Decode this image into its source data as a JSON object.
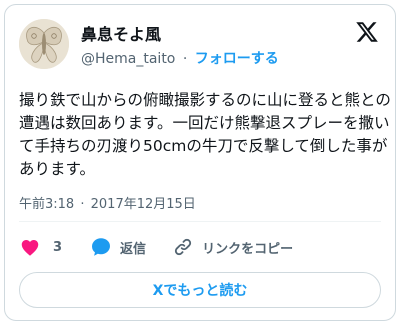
{
  "user": {
    "display_name": "鼻息そよ風",
    "handle": "@Hema_taito",
    "separator": "·",
    "follow_label": "フォローする"
  },
  "tweet": {
    "text": "撮り鉄で山からの俯瞰撮影するのに山に登ると熊との遭遇は数回あります。一回だけ熊撃退スプレーを撒いて手持ちの刃渡り50cmの牛刀で反撃して倒した事があります。",
    "time": "午前3:18",
    "separator": "·",
    "date": "2017年12月15日"
  },
  "actions": {
    "like_count": "3",
    "reply_label": "返信",
    "copy_link_label": "リンクをコピー"
  },
  "read_more_label": "Xでもっと読む",
  "icons": {
    "avatar": "avatar-image",
    "logo": "x-logo-icon",
    "like": "heart-icon",
    "reply": "speech-bubble-icon",
    "copy": "link-icon"
  },
  "colors": {
    "accent": "#1d9bf0",
    "like": "#f91880",
    "text": "#0f1419",
    "muted": "#536471",
    "border": "#cfd9de"
  }
}
